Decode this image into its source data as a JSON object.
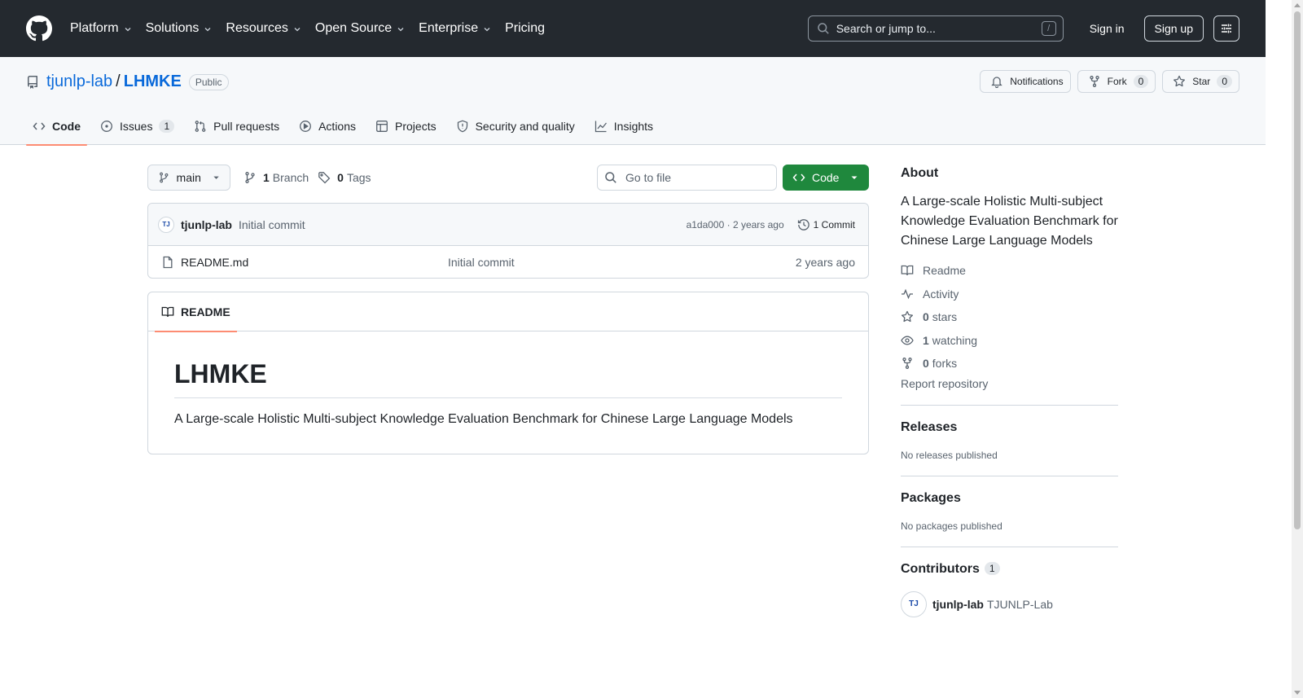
{
  "header": {
    "nav": [
      "Platform",
      "Solutions",
      "Resources",
      "Open Source",
      "Enterprise",
      "Pricing"
    ],
    "search_placeholder": "Search or jump to...",
    "search_kbd": "/",
    "sign_in": "Sign in",
    "sign_up": "Sign up"
  },
  "repo": {
    "owner": "tjunlp-lab",
    "separator": "/",
    "name": "LHMKE",
    "visibility": "Public",
    "notifications_label": "Notifications",
    "fork_label": "Fork",
    "fork_count": "0",
    "star_label": "Star",
    "star_count": "0"
  },
  "tabs": [
    {
      "label": "Code",
      "icon": "code-icon",
      "active": true
    },
    {
      "label": "Issues",
      "icon": "issue-opened-icon",
      "count": "1"
    },
    {
      "label": "Pull requests",
      "icon": "git-pull-request-icon"
    },
    {
      "label": "Actions",
      "icon": "play-icon"
    },
    {
      "label": "Projects",
      "icon": "table-icon"
    },
    {
      "label": "Security and quality",
      "icon": "shield-icon"
    },
    {
      "label": "Insights",
      "icon": "graph-icon"
    }
  ],
  "file_nav": {
    "branch": "main",
    "branches_count": "1",
    "branches_label": "Branch",
    "tags_count": "0",
    "tags_label": "Tags",
    "goto_placeholder": "Go to file",
    "code_button": "Code"
  },
  "latest_commit": {
    "avatar_text": "TJ",
    "author": "tjunlp-lab",
    "message": "Initial commit",
    "sha_time": "a1da000 · 2 years ago",
    "commits": "1 Commit"
  },
  "files": [
    {
      "name": "README.md",
      "message": "Initial commit",
      "age": "2 years ago"
    }
  ],
  "readme": {
    "tab_label": "README",
    "heading": "LHMKE",
    "body": "A Large-scale Holistic Multi-subject Knowledge Evaluation Benchmark for Chinese Large Language Models"
  },
  "sidebar": {
    "about_title": "About",
    "description": "A Large-scale Holistic Multi-subject Knowledge Evaluation Benchmark for Chinese Large Language Models",
    "readme": "Readme",
    "activity": "Activity",
    "stars_count": "0",
    "stars_label": "stars",
    "watching_count": "1",
    "watching_label": "watching",
    "forks_count": "0",
    "forks_label": "forks",
    "report": "Report repository",
    "releases_title": "Releases",
    "releases_text": "No releases published",
    "packages_title": "Packages",
    "packages_text": "No packages published",
    "contributors_title": "Contributors",
    "contributors_count": "1",
    "contributor": {
      "avatar_text": "TJ",
      "login": "tjunlp-lab",
      "name": "TJUNLP-Lab"
    }
  },
  "colors": {
    "header_bg": "#24292f",
    "link": "#0969da",
    "primary_button": "#1f883d",
    "active_tab_underline": "#fd8c73"
  }
}
